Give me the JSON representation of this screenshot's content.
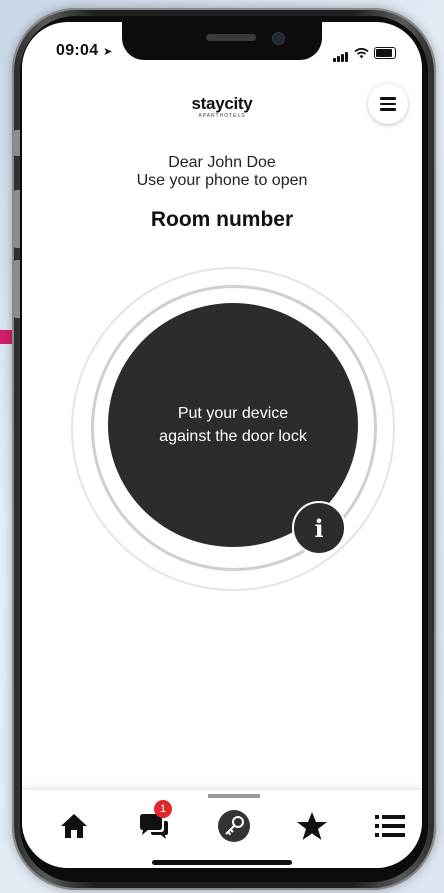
{
  "status_bar": {
    "time": "09:04"
  },
  "brand": {
    "logo_text": "staycity",
    "logo_subtext": "APARTHOTELS"
  },
  "greeting": {
    "line1": "Dear John Doe",
    "line2": "Use your phone to open"
  },
  "room": {
    "label": "Room number"
  },
  "unlock_circle": {
    "instruction": "Put your device against the door lock"
  },
  "tabbar": {
    "messages_badge": "1",
    "items": [
      {
        "icon": "home-icon"
      },
      {
        "icon": "chat-icon"
      },
      {
        "icon": "key-icon"
      },
      {
        "icon": "star-icon"
      },
      {
        "icon": "list-icon"
      }
    ]
  },
  "colors": {
    "dark": "#2b2c2e",
    "badge": "#e0292c",
    "white": "#ffffff"
  }
}
